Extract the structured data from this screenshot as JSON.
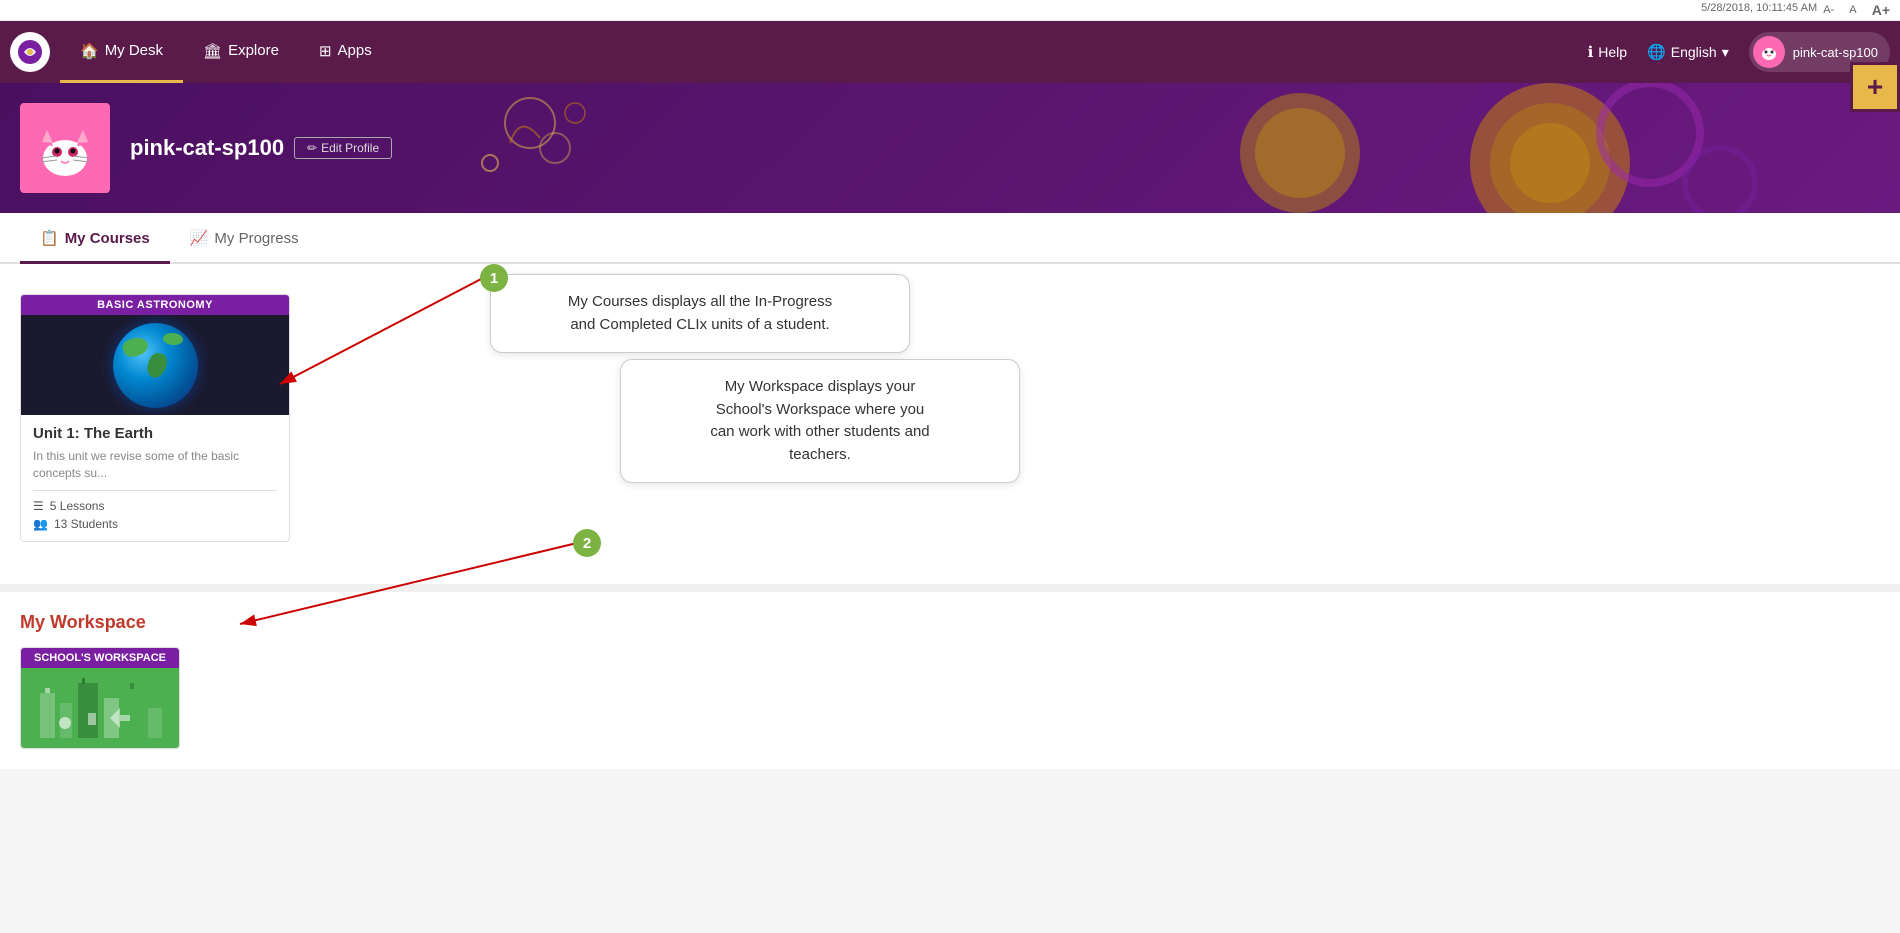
{
  "systembar": {
    "timestamp": "5/28/2018, 10:11:45 AM",
    "font_a_small": "A-",
    "font_a_normal": "A",
    "font_a_large": "A+"
  },
  "navbar": {
    "logo_alt": "Sunbird Logo",
    "nav_items": [
      {
        "id": "mydesk",
        "label": "My Desk",
        "icon": "🏠",
        "active": true
      },
      {
        "id": "explore",
        "label": "Explore",
        "icon": "🏛",
        "active": false
      },
      {
        "id": "apps",
        "label": "Apps",
        "icon": "⊞",
        "active": false
      }
    ],
    "help_label": "Help",
    "lang_label": "English",
    "lang_dropdown": "▾",
    "username": "pink-cat-sp100",
    "plus_button": "+"
  },
  "profile": {
    "username": "pink-cat-sp100",
    "edit_button": "Edit Profile",
    "avatar_emoji": "🐱"
  },
  "tabs": [
    {
      "id": "my-courses",
      "label": "My Courses",
      "icon": "📋",
      "active": true
    },
    {
      "id": "my-progress",
      "label": "My Progress",
      "icon": "📈",
      "active": false
    }
  ],
  "tooltip1": {
    "text": "My Courses displays all the In-Progress\nand Completed CLIx units of a student."
  },
  "tooltip2": {
    "text": "My Workspace displays your\nSchool's Workspace where you\ncan work with other students and\nteachers."
  },
  "annotation1": {
    "number": "1"
  },
  "annotation2": {
    "number": "2"
  },
  "courses_section": {
    "course_card": {
      "badge": "BASIC ASTRONOMY",
      "title": "Unit 1: The Earth",
      "description": "In this unit we revise some of the basic concepts su...",
      "lessons_label": "5 Lessons",
      "students_label": "13 Students"
    }
  },
  "workspace_section": {
    "title": "My Workspace",
    "card": {
      "badge": "SCHOOL'S WORKSPACE"
    }
  }
}
